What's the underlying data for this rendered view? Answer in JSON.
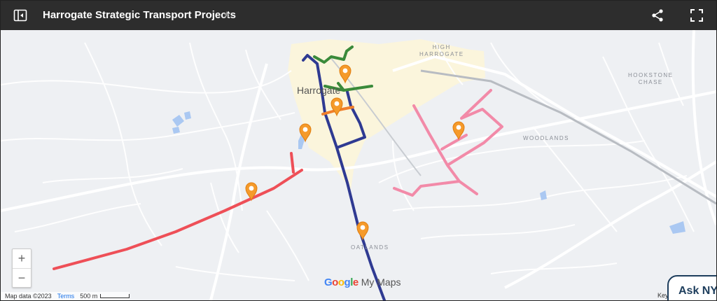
{
  "header": {
    "title": "Harrogate Strategic Transport Projects",
    "star": "★"
  },
  "map": {
    "town_label": "Harrogate",
    "areas": {
      "high_harrogate": "HIGH\nHARROGATE",
      "hookstone_chase": "HOOKSTONE\nCHASE",
      "woodlands": "WOODLANDS",
      "oatlands": "OATLANDS"
    },
    "colors": {
      "blue_route": "#2f3a92",
      "red_route": "#ee4f57",
      "pink_route": "#f28aa8",
      "green_route": "#3a8a3a",
      "orange_route": "#f07f2a",
      "marker": "#f59a2a",
      "town_centre": "#fbf5dc"
    }
  },
  "controls": {
    "zoom_in": "+",
    "zoom_out": "−"
  },
  "footer": {
    "map_data": "Map data ©2023",
    "terms": "Terms",
    "scale": "500 m",
    "key": "Key"
  },
  "watermark": {
    "google": "Google",
    "my_maps": "My Maps"
  },
  "ask_button": "Ask NYE"
}
